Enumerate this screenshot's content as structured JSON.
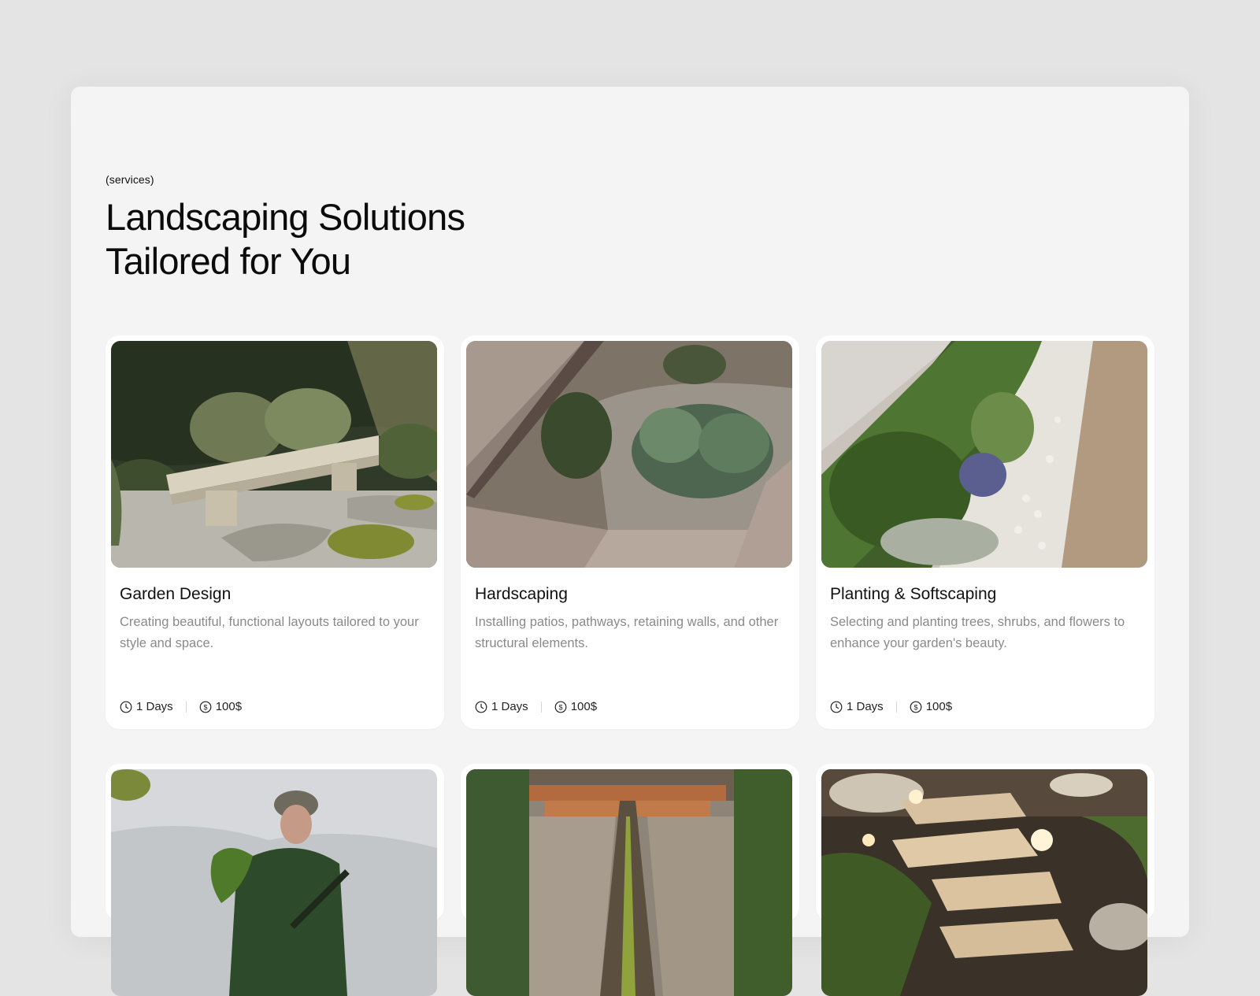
{
  "section": {
    "eyebrow": "(services)",
    "heading_line1": "Landscaping Solutions",
    "heading_line2": "Tailored for You"
  },
  "services": [
    {
      "title": "Garden Design",
      "description": "Creating beautiful, functional layouts tailored to your style and space.",
      "duration": "1 Days",
      "price": "100$",
      "image": "stone-bench-garden"
    },
    {
      "title": "Hardscaping",
      "description": "Installing patios, pathways, retaining walls, and other structural elements.",
      "duration": "1 Days",
      "price": "100$",
      "image": "paved-planter-aerial"
    },
    {
      "title": "Planting & Softscaping",
      "description": "Selecting and planting trees, shrubs, and flowers to enhance your garden's beauty.",
      "duration": "1 Days",
      "price": "100$",
      "image": "hedge-and-pebbles"
    },
    {
      "image": "gardener-with-plant"
    },
    {
      "image": "water-channel-path"
    },
    {
      "image": "stepping-stone-lights"
    }
  ],
  "icons": {
    "duration": "clock-icon",
    "price": "dollar-coin-icon"
  }
}
